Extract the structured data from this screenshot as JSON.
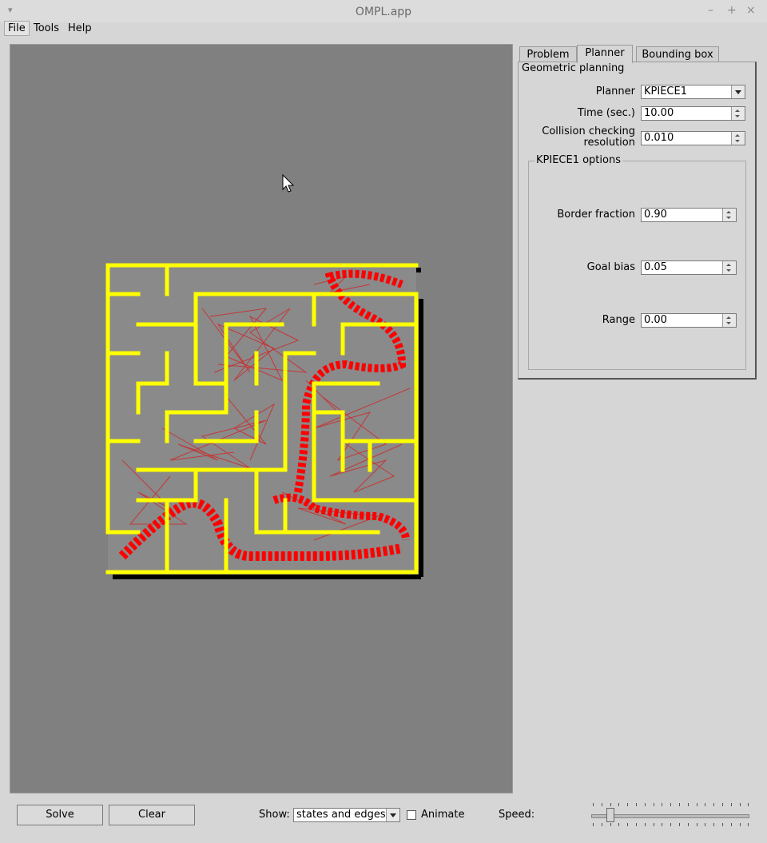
{
  "window": {
    "title": "OMPL.app",
    "menu_glyph": "▾",
    "minimize": "–",
    "maximize": "+",
    "close": "×"
  },
  "menubar": {
    "items": [
      "File",
      "Tools",
      "Help"
    ],
    "active": "File"
  },
  "tabs": [
    {
      "label": "Problem",
      "active": false
    },
    {
      "label": "Planner",
      "active": true
    },
    {
      "label": "Bounding box",
      "active": false
    }
  ],
  "planner_panel": {
    "group_title": "Geometric planning",
    "planner_label": "Planner",
    "planner_value": "KPIECE1",
    "time_label": "Time (sec.)",
    "time_value": "10.00",
    "collision_label_line1": "Collision checking",
    "collision_label_line2": "resolution",
    "collision_value": "0.010",
    "options_title": "KPIECE1 options",
    "border_fraction_label": "Border fraction",
    "border_fraction_value": "0.90",
    "goal_bias_label": "Goal bias",
    "goal_bias_value": "0.05",
    "range_label": "Range",
    "range_value": "0.00"
  },
  "bottom_bar": {
    "solve_label": "Solve",
    "clear_label": "Clear",
    "show_label": "Show:",
    "show_value": "states and edges",
    "animate_label": "Animate",
    "animate_checked": false,
    "speed_label": "Speed:",
    "speed_fraction": 0.1
  },
  "colors": {
    "viewport_bg": "#808080",
    "maze_wall": "#ffff00",
    "path_states": "#ff0000",
    "edges": "#cc2a2a"
  }
}
